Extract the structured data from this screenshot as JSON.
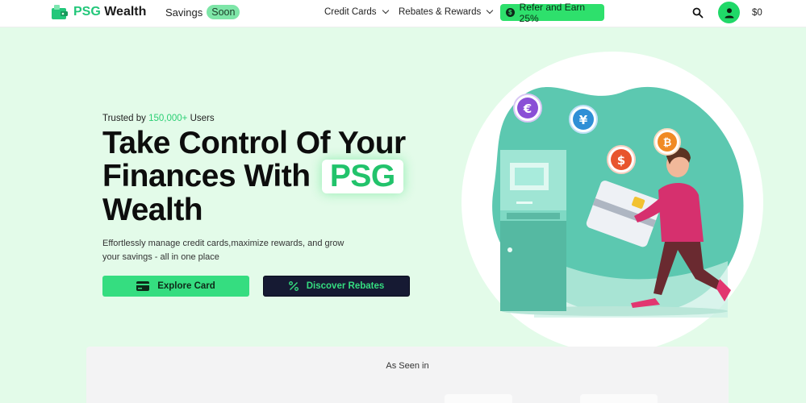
{
  "header": {
    "logo_text_brand": "PSG",
    "logo_text_rest": " Wealth",
    "savings_label": "Savings",
    "soon_badge": "Soon",
    "nav": [
      {
        "label": "Credit Cards"
      },
      {
        "label": "Rebates & Rewards"
      }
    ],
    "refer_label": "Refer and Earn 25%",
    "balance": "$0"
  },
  "hero": {
    "trusted_prefix": "Trusted by ",
    "trusted_count": "150,000+",
    "trusted_suffix": " Users",
    "headline_line1": "Take Control Of Your",
    "headline_line2": "Finances With",
    "headline_badge": "PSG",
    "headline_line3": "Wealth",
    "description": "Effortlessly manage credit cards,maximize rewards, and grow your savings - all in one place",
    "explore_label": "Explore Card",
    "discover_label": "Discover Rebates"
  },
  "seen_in": {
    "label": "As Seen in"
  },
  "illustration": {
    "currency_symbols": [
      "€",
      "¥",
      "$",
      "₿"
    ]
  },
  "colors": {
    "accent": "#2ee06c",
    "hero_bg": "#e3fbe9",
    "dark_button": "#161a33"
  }
}
